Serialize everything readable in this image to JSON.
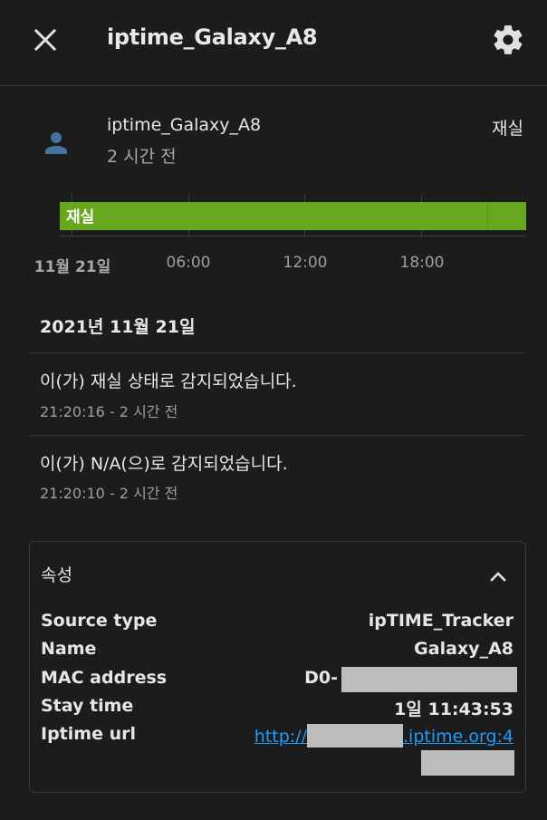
{
  "header": {
    "title": "iptime_Galaxy_A8",
    "close_icon": "close-icon",
    "settings_icon": "gear-icon"
  },
  "entity": {
    "name": "iptime_Galaxy_A8",
    "last_changed": "2 시간 전",
    "state": "재실",
    "icon": "person-icon",
    "icon_color": "#44739e"
  },
  "timeline": {
    "bar_label": "재실",
    "bar_color": "#67a71e",
    "ticks": [
      "11월 21일",
      "06:00",
      "12:00",
      "18:00"
    ]
  },
  "logbook": {
    "date": "2021년 11월 21일",
    "entries": [
      {
        "message": "이(가) 재실 상태로 감지되었습니다.",
        "time": "21:20:16 - 2 시간 전"
      },
      {
        "message": "이(가) N/A(으)로 감지되었습니다.",
        "time": "21:20:10 - 2 시간 전"
      }
    ]
  },
  "attributes": {
    "title": "속성",
    "expand_icon": "chevron-up-icon",
    "rows": [
      {
        "key": "Source type",
        "value": "ipTIME_Tracker"
      },
      {
        "key": "Name",
        "value": "Galaxy_A8"
      },
      {
        "key": "MAC address",
        "value": "D0-"
      },
      {
        "key": "Stay time",
        "value": "1일 11:43:53"
      },
      {
        "key": "Iptime url",
        "value_prefix": "http://",
        "value_suffix": ".iptime.org:4"
      }
    ]
  }
}
